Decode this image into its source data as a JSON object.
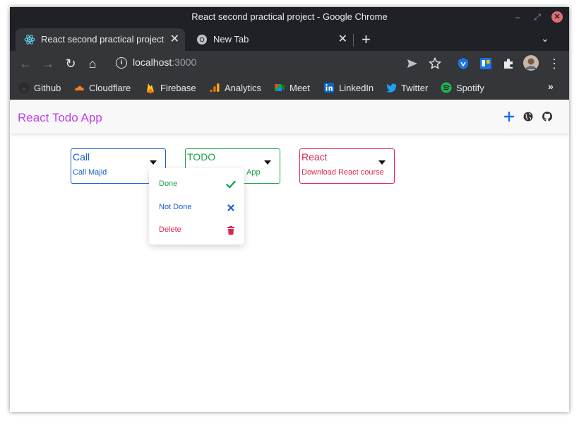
{
  "window": {
    "title": "React second practical project - Google Chrome",
    "controls": {
      "minimize": "–",
      "restore": "⤢",
      "close": "✕"
    }
  },
  "tabs": [
    {
      "label": "React second practical project",
      "icon": "react-icon",
      "active": true,
      "close": "✕"
    },
    {
      "label": "New Tab",
      "icon": "chrome-icon",
      "active": false,
      "close": "✕"
    }
  ],
  "tabstrip": {
    "new_tab": "+",
    "tab_search": "⌄"
  },
  "toolbar": {
    "url_host": "localhost",
    "url_port": ":3000",
    "back": "←",
    "forward": "→",
    "reload": "↻",
    "home": "⌂",
    "menu": "⋮"
  },
  "bookmarks": [
    {
      "label": "Github",
      "icon": "github-icon",
      "color": "#2b2b2b"
    },
    {
      "label": "Cloudflare",
      "icon": "cloudflare-icon",
      "color": "#f38020"
    },
    {
      "label": "Firebase",
      "icon": "firebase-icon",
      "color": "#ffca28"
    },
    {
      "label": "Analytics",
      "icon": "analytics-icon",
      "color": "#f9ab00"
    },
    {
      "label": "Meet",
      "icon": "meet-icon",
      "color": "#00ac47"
    },
    {
      "label": "LinkedIn",
      "icon": "linkedin-icon",
      "color": "#0a66c2"
    },
    {
      "label": "Twitter",
      "icon": "twitter-icon",
      "color": "#1da1f2"
    },
    {
      "label": "Spotify",
      "icon": "spotify-icon",
      "color": "#1db954"
    }
  ],
  "bookmarks_more": "»",
  "app": {
    "title": "React Todo App",
    "title_color": "#c040e8",
    "actions": [
      {
        "name": "add-icon",
        "color": "#1a73e8"
      },
      {
        "name": "globe-icon",
        "color": "#333333"
      },
      {
        "name": "github-icon",
        "color": "#333333"
      }
    ]
  },
  "cards": [
    {
      "title": "Call",
      "body": "Call Majid",
      "status": "not-done",
      "color": "#1a5fd0"
    },
    {
      "title": "TODO",
      "body": "App",
      "status": "done",
      "color": "#1aa34a"
    },
    {
      "title": "React",
      "body": "Download React course",
      "status": "deleted",
      "color": "#dc2650"
    }
  ],
  "menu": {
    "items": [
      {
        "label": "Done",
        "icon": "check-icon",
        "color": "#1aa34a"
      },
      {
        "label": "Not Done",
        "icon": "close-icon",
        "color": "#1a5fd0"
      },
      {
        "label": "Delete",
        "icon": "trash-icon",
        "color": "#dc2650"
      }
    ]
  }
}
